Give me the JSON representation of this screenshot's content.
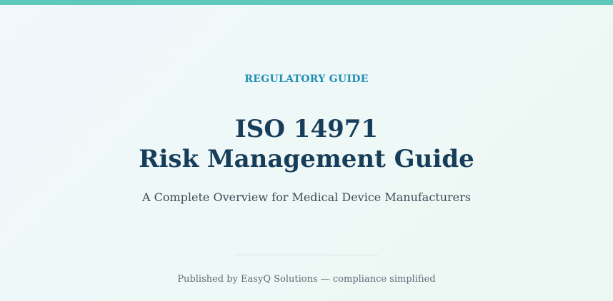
{
  "cover": {
    "eyebrow": "REGULATORY GUIDE",
    "title_line1": "ISO 14971",
    "title_line2": "Risk Management Guide",
    "subtitle": "A Complete Overview for Medical Device Manufacturers",
    "footer": "Published by EasyQ Solutions — compliance simplified"
  },
  "colors": {
    "accent_bar": "#5ec8bb",
    "eyebrow": "#1f8fb5",
    "title": "#163d5a"
  }
}
